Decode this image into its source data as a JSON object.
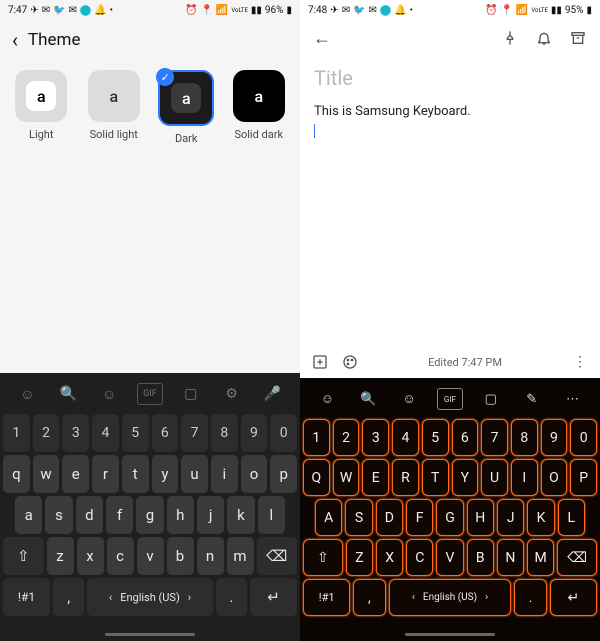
{
  "left": {
    "status": {
      "time": "7:47",
      "battery": "96%",
      "network_label": "VoLTE"
    },
    "title": "Theme",
    "themes": [
      {
        "id": "light",
        "label": "Light",
        "glyph": "a"
      },
      {
        "id": "solid-light",
        "label": "Solid light",
        "glyph": "a"
      },
      {
        "id": "dark",
        "label": "Dark",
        "glyph": "a",
        "selected": true
      },
      {
        "id": "solid-dark",
        "label": "Solid dark",
        "glyph": "a"
      }
    ],
    "keyboard": {
      "toolbar_icons": [
        "emoji-icon",
        "search-icon",
        "sticker-icon",
        "gif-icon",
        "clipboard-icon",
        "settings-icon",
        "voice-icon"
      ],
      "row_num": [
        "1",
        "2",
        "3",
        "4",
        "5",
        "6",
        "7",
        "8",
        "9",
        "0"
      ],
      "row_q": [
        "q",
        "w",
        "e",
        "r",
        "t",
        "y",
        "u",
        "i",
        "o",
        "p"
      ],
      "row_a": [
        "a",
        "s",
        "d",
        "f",
        "g",
        "h",
        "j",
        "k",
        "l"
      ],
      "row_z": [
        "z",
        "x",
        "c",
        "v",
        "b",
        "n",
        "m"
      ],
      "shift": "⇧",
      "backspace": "⌫",
      "sym": "!#1",
      "comma": ",",
      "space": "English (US)",
      "period": ".",
      "enter": "↵"
    }
  },
  "right": {
    "status": {
      "time": "7:48",
      "battery": "95%",
      "network_label": "VoLTE"
    },
    "note": {
      "title_placeholder": "Title",
      "body": "This is Samsung Keyboard.",
      "edited_label": "Edited 7:47 PM"
    },
    "keyboard": {
      "toolbar_icons": [
        "emoji-icon",
        "search-icon",
        "sticker-icon",
        "gif-icon",
        "clipboard-icon",
        "pen-icon",
        "more-icon"
      ],
      "row_num": [
        "1",
        "2",
        "3",
        "4",
        "5",
        "6",
        "7",
        "8",
        "9",
        "0"
      ],
      "row_q": [
        "Q",
        "W",
        "E",
        "R",
        "T",
        "Y",
        "U",
        "I",
        "O",
        "P"
      ],
      "row_a": [
        "A",
        "S",
        "D",
        "F",
        "G",
        "H",
        "J",
        "K",
        "L"
      ],
      "row_z": [
        "Z",
        "X",
        "C",
        "V",
        "B",
        "N",
        "M"
      ],
      "shift": "⇧",
      "backspace": "⌫",
      "sym": "!#1",
      "comma": ",",
      "space": "English (US)",
      "period": ".",
      "enter": "↵"
    }
  }
}
